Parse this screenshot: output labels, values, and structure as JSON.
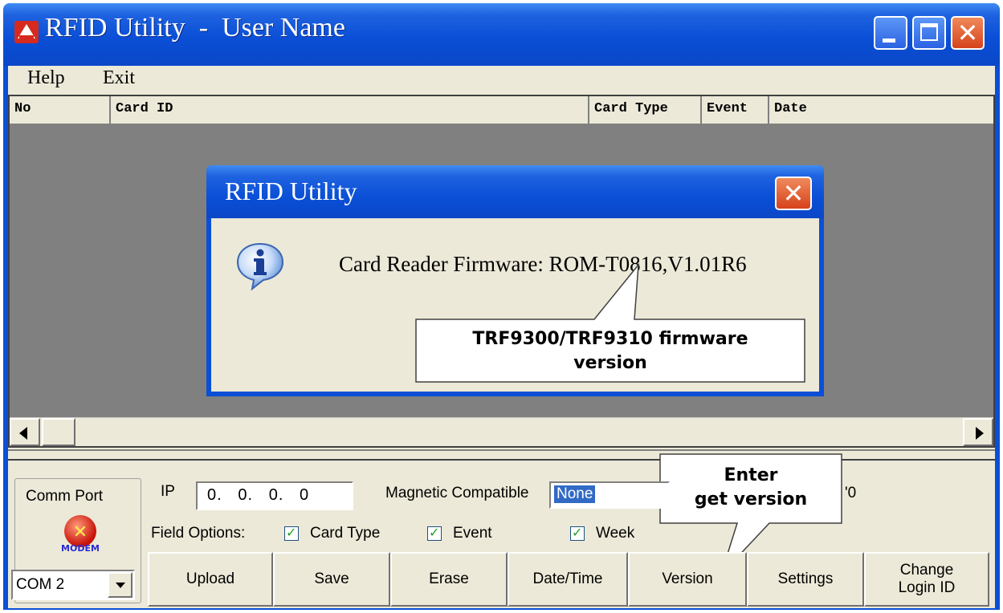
{
  "window": {
    "title": "RFID Utility  -  User Name"
  },
  "menu": {
    "items": [
      {
        "label": "Help"
      },
      {
        "label": "Exit"
      }
    ]
  },
  "list": {
    "columns": [
      "No",
      "Card ID",
      "Card Type",
      "Event",
      "Date"
    ]
  },
  "dialog": {
    "title": "RFID Utility",
    "message": "Card Reader Firmware: ROM-T0816,V1.01R6"
  },
  "callouts": {
    "firmware": {
      "line1": "TRF9300/TRF9310 firmware",
      "line2": "version"
    },
    "version": {
      "line1": "Enter",
      "line2": "get version"
    }
  },
  "comm_port": {
    "label": "Comm Port",
    "modem_label": "MODEM",
    "selected": "COM 2"
  },
  "ip": {
    "label": "IP",
    "value": "0.   0.   0.   0"
  },
  "magnetic": {
    "label": "Magnetic Compatible",
    "selected": "None",
    "trailing_text": "'0"
  },
  "field_options": {
    "label": "Field Options:",
    "card_type": {
      "label": "Card Type",
      "checked": true
    },
    "event": {
      "label": "Event",
      "checked": true
    },
    "week": {
      "label": "Week",
      "checked": true
    }
  },
  "buttons": {
    "upload": "Upload",
    "save": "Save",
    "erase": "Erase",
    "datetime": "Date/Time",
    "version": "Version",
    "settings": "Settings",
    "change_login_1": "Change",
    "change_login_2": "Login ID"
  },
  "colors": {
    "titlebar": "#0a4fd6",
    "face": "#ece9d8",
    "list_bg": "#808080",
    "close_red": "#d6421c",
    "selection": "#316ac5"
  }
}
